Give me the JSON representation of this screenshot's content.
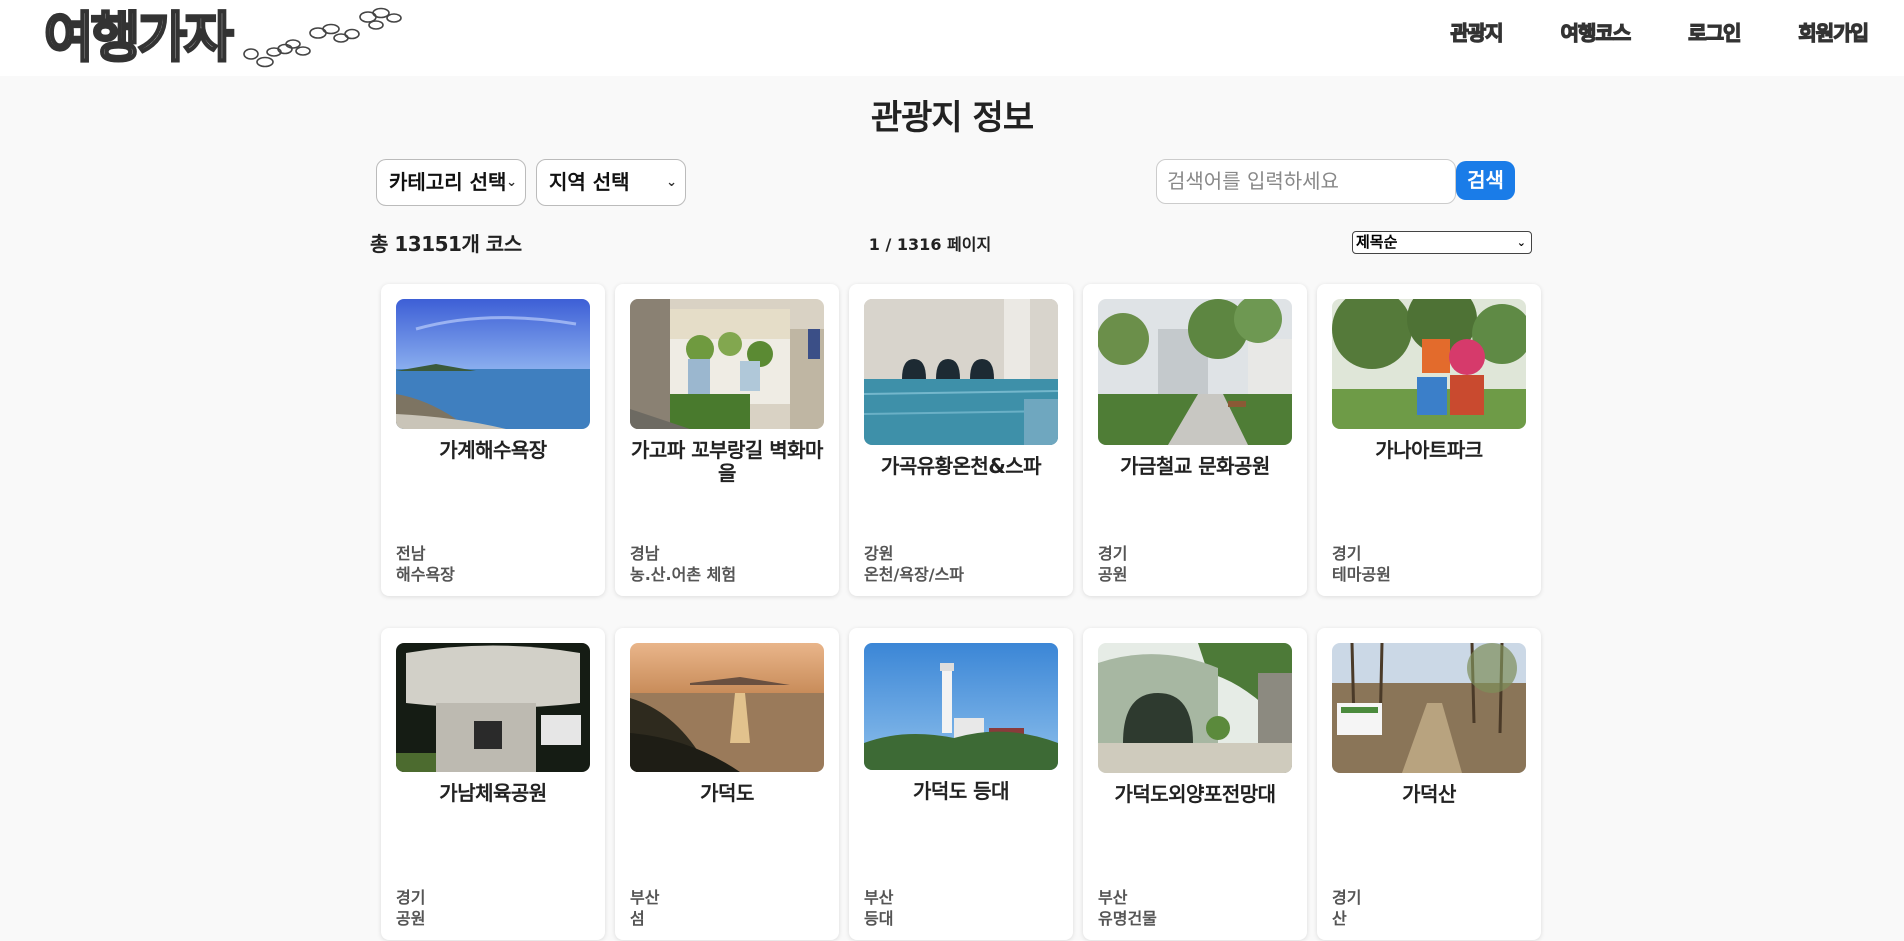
{
  "header": {
    "logo_text": "여행가자",
    "nav": [
      "관광지",
      "여행코스",
      "로그인",
      "회원가입"
    ]
  },
  "page_title": "관광지 정보",
  "filters": {
    "category_select": "카테고리 선택",
    "region_select": "지역 선택",
    "search_placeholder": "검색어를 입력하세요",
    "search_button": "검색"
  },
  "meta": {
    "total_count": "총 13151개 코스",
    "page_indicator": "1 / 1316 페이지",
    "sort_select": "제목순"
  },
  "cards": [
    {
      "name": "가계해수욕장",
      "region": "전남",
      "category": "해수욕장",
      "image": "sea-coast"
    },
    {
      "name": "가고파 꼬부랑길 벽화마을",
      "region": "경남",
      "category": "농.산.어촌 체험",
      "image": "mural-alley"
    },
    {
      "name": "가곡유황온천&스파",
      "region": "강원",
      "category": "온천/욕장/스파",
      "image": "indoor-pool"
    },
    {
      "name": "가금철교 문화공원",
      "region": "경기",
      "category": "공원",
      "image": "park-path"
    },
    {
      "name": "가나아트파크",
      "region": "경기",
      "category": "테마공원",
      "image": "love-sculpture"
    },
    {
      "name": "가남체육공원",
      "region": "경기",
      "category": "공원",
      "image": "stone-sign"
    },
    {
      "name": "가덕도",
      "region": "부산",
      "category": "섬",
      "image": "sunset-island"
    },
    {
      "name": "가덕도 등대",
      "region": "부산",
      "category": "등대",
      "image": "lighthouse"
    },
    {
      "name": "가덕도외양포전망대",
      "region": "부산",
      "category": "유명건물",
      "image": "tunnel-hill"
    },
    {
      "name": "가덕산",
      "region": "경기",
      "category": "산",
      "image": "forest-trail"
    }
  ],
  "colors": {
    "search_button": "#1a7ce8",
    "background": "#f9f9f9"
  }
}
